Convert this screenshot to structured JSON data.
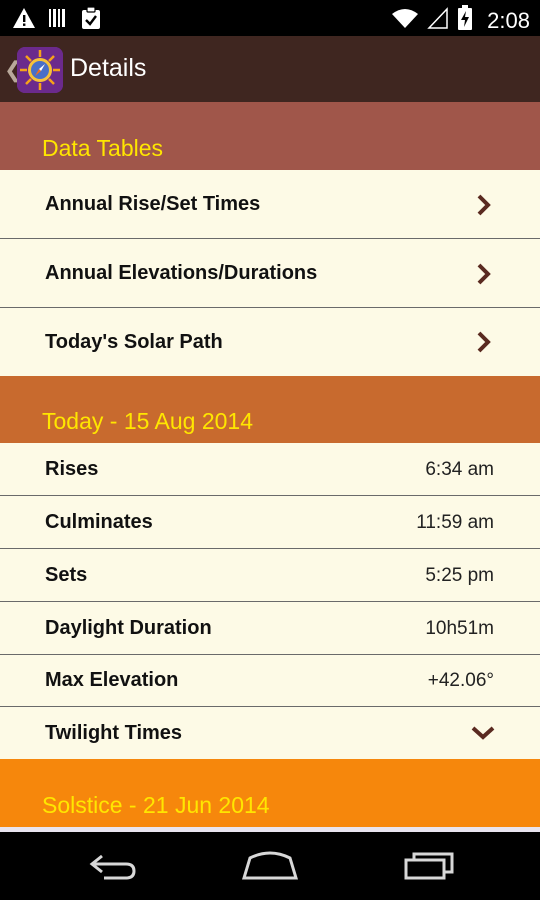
{
  "status_bar": {
    "time": "2:08",
    "icons": [
      "warning-icon",
      "barcode-icon",
      "clipboard-check-icon",
      "wifi-icon",
      "signal-icon",
      "battery-charging-icon"
    ]
  },
  "action_bar": {
    "title": "Details",
    "logo_icon": "compass-sun-icon"
  },
  "data_tables": {
    "header": "Data Tables",
    "items": [
      {
        "label": "Annual Rise/Set Times"
      },
      {
        "label": "Annual Elevations/Durations"
      },
      {
        "label": "Today's Solar Path"
      }
    ]
  },
  "today": {
    "header": "Today - 15 Aug 2014",
    "rows": [
      {
        "label": "Rises",
        "value": "6:34 am"
      },
      {
        "label": "Culminates",
        "value": "11:59 am"
      },
      {
        "label": "Sets",
        "value": "5:25 pm"
      },
      {
        "label": "Daylight Duration",
        "value": "10h51m"
      },
      {
        "label": "Max Elevation",
        "value": "+42.06°"
      }
    ],
    "twilight_label": "Twilight Times"
  },
  "solstice": {
    "header": "Solstice - 21 Jun 2014"
  },
  "colors": {
    "header_text": "#ffe600",
    "data_tables_header_bg": "#a0564a",
    "today_header_bg": "#c86a2e",
    "solstice_header_bg": "#f6870c",
    "row_bg": "#fdfae6",
    "chevron": "#5a2a20"
  },
  "nav_bar": {
    "icons": [
      "back-icon",
      "home-icon",
      "recents-icon"
    ]
  }
}
